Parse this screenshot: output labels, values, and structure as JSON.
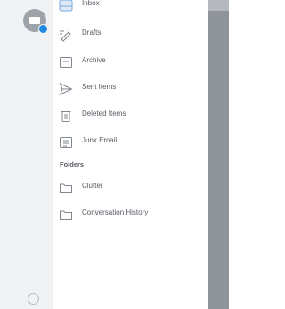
{
  "menu": {
    "items": [
      {
        "label": "Inbox",
        "icon": "inbox-icon"
      },
      {
        "label": "Drafts",
        "icon": "drafts-icon"
      },
      {
        "label": "Archive",
        "icon": "archive-icon"
      },
      {
        "label": "Sent Items",
        "icon": "send-icon"
      },
      {
        "label": "Deleted Items",
        "icon": "trash-icon"
      },
      {
        "label": "Junk Email",
        "icon": "junk-icon"
      }
    ],
    "folders_heading": "Folders",
    "folders": [
      {
        "label": "Clutter",
        "icon": "folder-icon"
      },
      {
        "label": "Conversation History",
        "icon": "folder-icon"
      }
    ]
  },
  "colors": {
    "accent": "#1e88e5",
    "rail_bg": "#f1f2f4",
    "overlay": "#8f949b"
  }
}
